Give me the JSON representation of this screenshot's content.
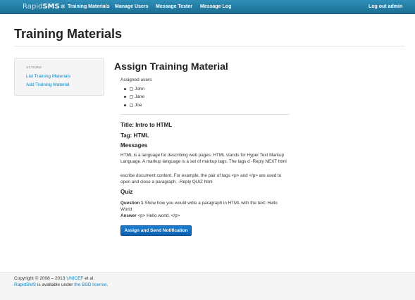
{
  "navbar": {
    "brand_prefix": "Rapid",
    "brand_strong": "SMS",
    "links": [
      "Training Materials",
      "Manage Users",
      "Message Tester",
      "Message Log"
    ],
    "logout": "Log out admin"
  },
  "page": {
    "title": "Training Materials"
  },
  "sidebar": {
    "header": "ACTIONS",
    "items": [
      "List Training Materials",
      "Add Training Material"
    ]
  },
  "main": {
    "heading": "Assign Training Material",
    "assigned_label": "Assigned users",
    "users": [
      "John",
      "Jane",
      "Joe"
    ],
    "title_line": "Title: Intro to HTML",
    "tag_line": "Tag: HTML",
    "messages_heading": "Messages",
    "message_1": "HTML is a language for describing web pages. HTML stands for Hyper Text Markup Language. A markup language is a set of markup tags. The tags d -Reply NEXT html",
    "message_2": "escribe document content. For example, the pair of tags <p> and </p> are used to open and close a paragraph. -Reply QUIZ html",
    "quiz_heading": "Quiz",
    "question_label": "Question 1",
    "question_text": " Show how you would write a paragraph in HTML with the text: Hello World",
    "answer_label": "Answer",
    "answer_text": " <p> Hello world. </p>",
    "button_label": "Assign and Send Notification"
  },
  "footer": {
    "copyright_prefix": "Copyright © 2008 – 2013 ",
    "unicef": "UNICEF",
    "copyright_suffix": " et al.",
    "rapidsms": "RapidSMS",
    "license_middle": " is available under ",
    "license_link": "the BSD license",
    "license_end": "."
  },
  "colors": {
    "navbar": "#2187b3",
    "link": "#0088cc",
    "button": "#0b67c0"
  }
}
